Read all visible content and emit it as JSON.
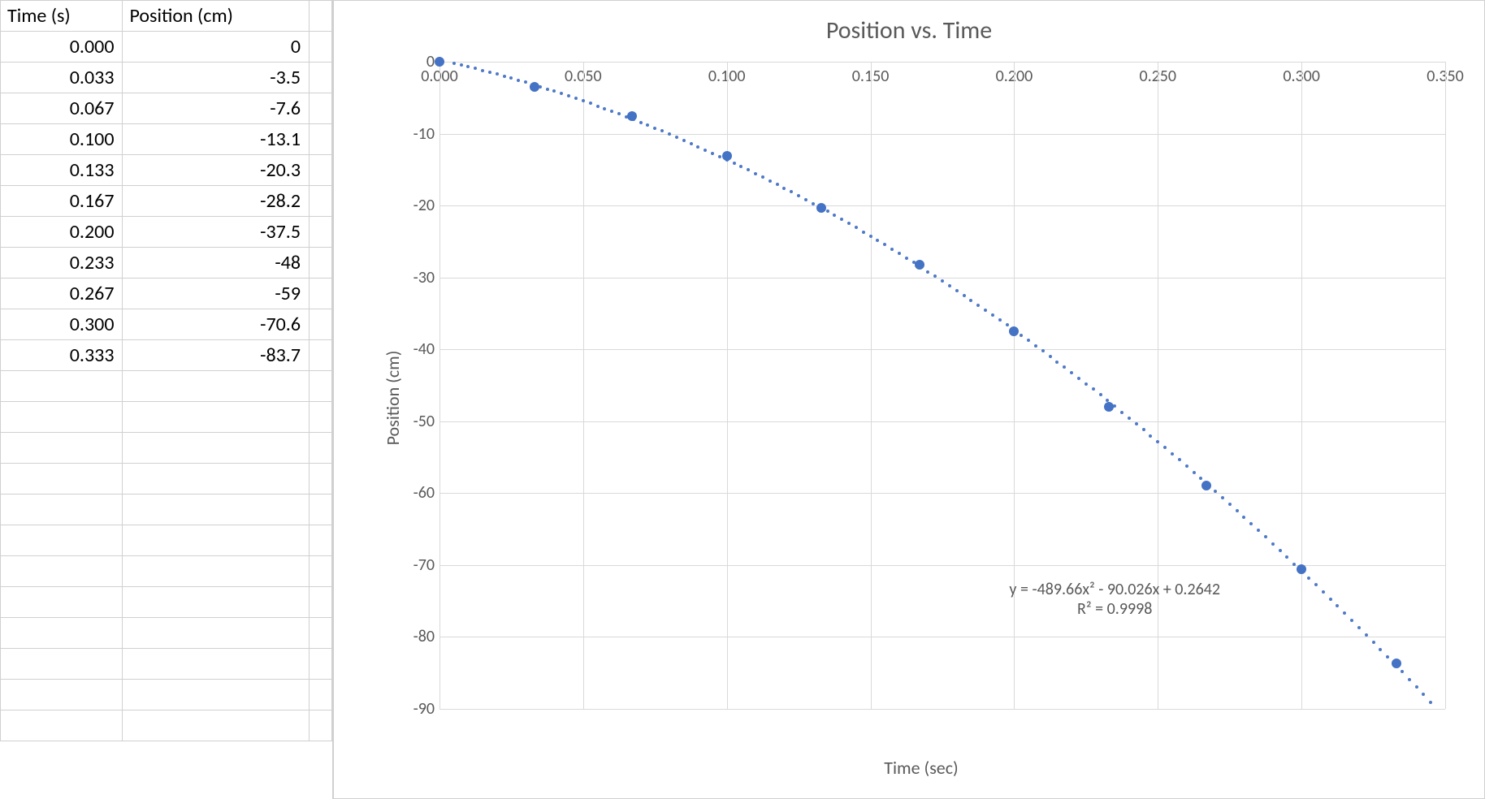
{
  "table": {
    "headers": [
      "Time (s)",
      "Position (cm)"
    ],
    "rows": [
      {
        "t": "0.000",
        "p": "0"
      },
      {
        "t": "0.033",
        "p": "-3.5"
      },
      {
        "t": "0.067",
        "p": "-7.6"
      },
      {
        "t": "0.100",
        "p": "-13.1"
      },
      {
        "t": "0.133",
        "p": "-20.3"
      },
      {
        "t": "0.167",
        "p": "-28.2"
      },
      {
        "t": "0.200",
        "p": "-37.5"
      },
      {
        "t": "0.233",
        "p": "-48"
      },
      {
        "t": "0.267",
        "p": "-59"
      },
      {
        "t": "0.300",
        "p": "-70.6"
      },
      {
        "t": "0.333",
        "p": "-83.7"
      }
    ],
    "empty_rows_after": 12
  },
  "chart": {
    "title": "Position vs. Time",
    "xlabel": "Time (sec)",
    "ylabel": "Position (cm)",
    "trendline_eq": "y = -489.66x² - 90.026x + 0.2642",
    "trendline_r2": "R² = 0.9998",
    "yticks": [
      "0",
      "-10",
      "-20",
      "-30",
      "-40",
      "-50",
      "-60",
      "-70",
      "-80",
      "-90"
    ],
    "xticks": [
      "0.000",
      "0.050",
      "0.100",
      "0.150",
      "0.200",
      "0.250",
      "0.300",
      "0.350"
    ]
  },
  "chart_data": {
    "type": "scatter",
    "title": "Position vs. Time",
    "xlabel": "Time (sec)",
    "ylabel": "Position (cm)",
    "xlim": [
      0.0,
      0.35
    ],
    "ylim": [
      -90,
      0
    ],
    "x": [
      0.0,
      0.033,
      0.067,
      0.1,
      0.133,
      0.167,
      0.2,
      0.233,
      0.267,
      0.3,
      0.333
    ],
    "y": [
      0,
      -3.5,
      -7.6,
      -13.1,
      -20.3,
      -28.2,
      -37.5,
      -48,
      -59,
      -70.6,
      -83.7
    ],
    "trendline": {
      "type": "polynomial",
      "order": 2,
      "coefficients": [
        -489.66,
        -90.026,
        0.2642
      ],
      "equation": "y = -489.66x² - 90.026x + 0.2642",
      "r_squared": 0.9998
    }
  },
  "colors": {
    "series": "#4472C4",
    "text_muted": "#595959",
    "grid": "#d9d9d9"
  }
}
